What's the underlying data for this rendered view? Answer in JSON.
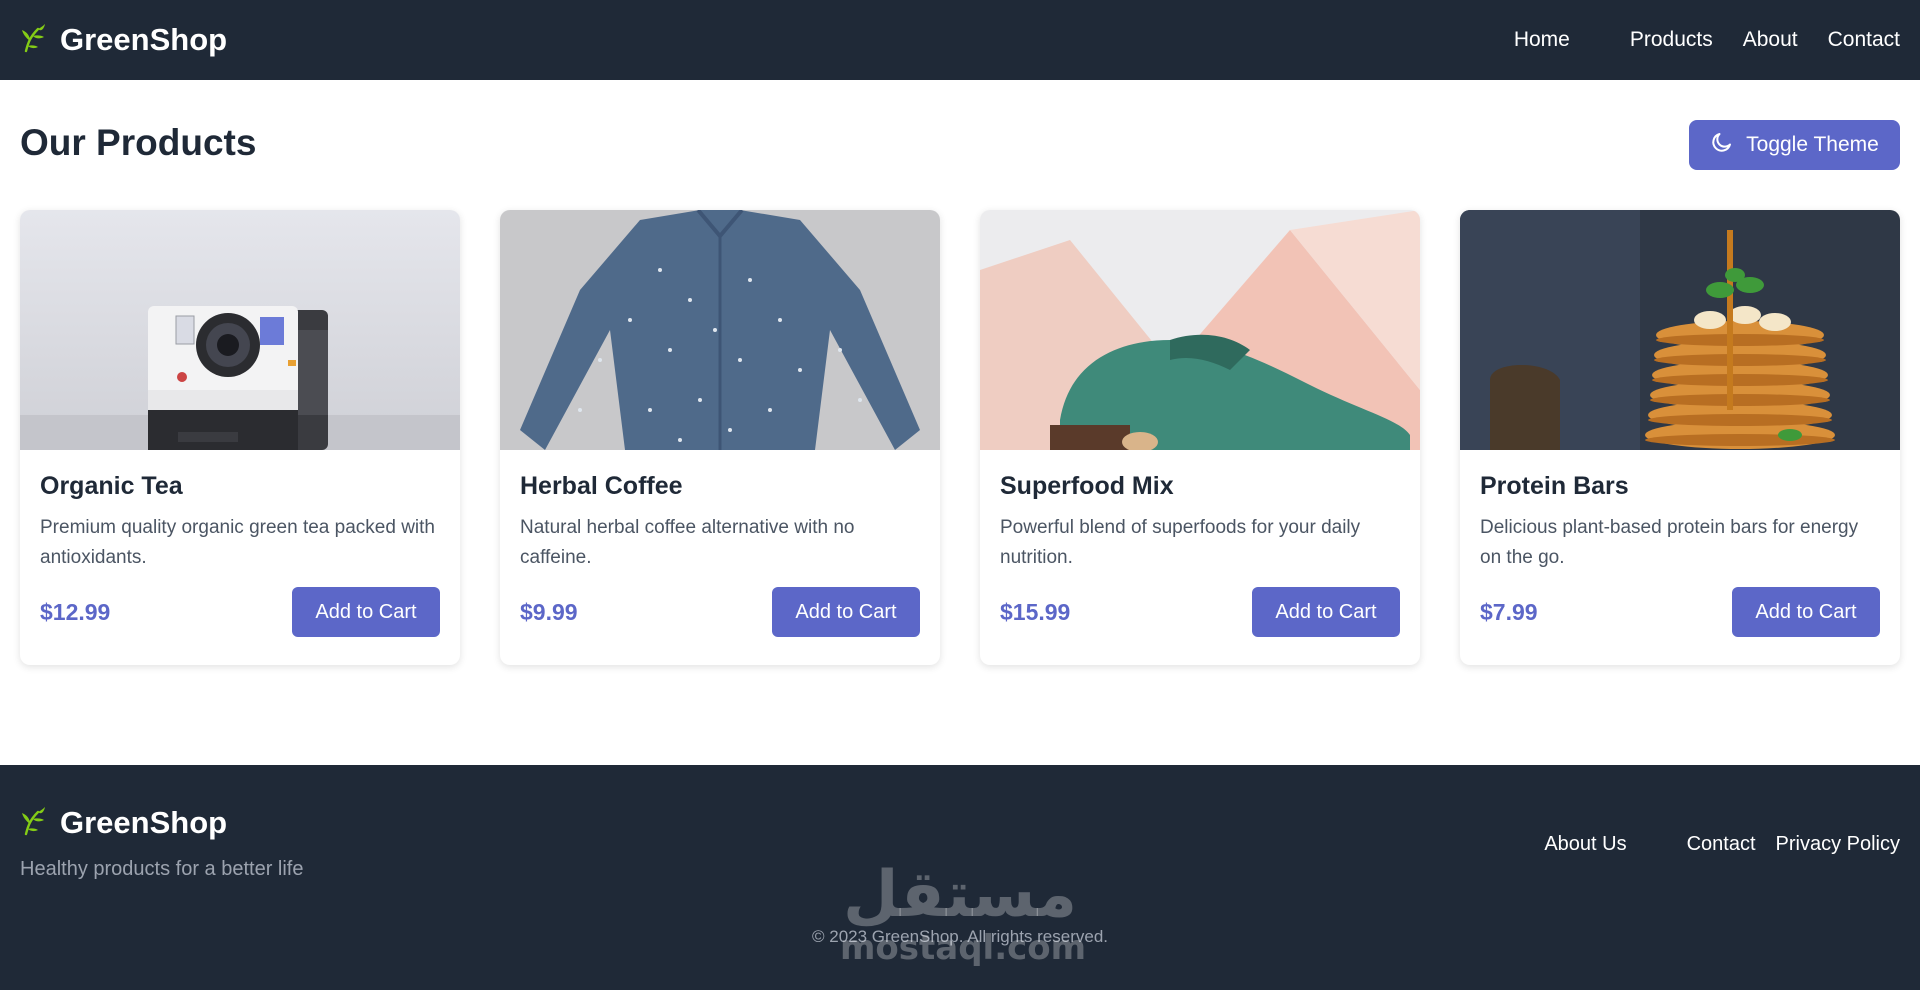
{
  "navbar": {
    "brand": "GreenShop",
    "links": [
      "Home",
      "Products",
      "About",
      "Contact"
    ]
  },
  "main": {
    "title": "Our Products",
    "theme_button": "Toggle Theme"
  },
  "products": [
    {
      "name": "Organic Tea",
      "description": "Premium quality organic green tea packed with antioxidants.",
      "price": "$12.99",
      "button": "Add to Cart"
    },
    {
      "name": "Herbal Coffee",
      "description": "Natural herbal coffee alternative with no caffeine.",
      "price": "$9.99",
      "button": "Add to Cart"
    },
    {
      "name": "Superfood Mix",
      "description": "Powerful blend of superfoods for your daily nutrition.",
      "price": "$15.99",
      "button": "Add to Cart"
    },
    {
      "name": "Protein Bars",
      "description": "Delicious plant-based protein bars for energy on the go.",
      "price": "$7.99",
      "button": "Add to Cart"
    }
  ],
  "footer": {
    "brand": "GreenShop",
    "tagline": "Healthy products for a better life",
    "links": [
      "About Us",
      "Contact",
      "Privacy Policy"
    ],
    "copyright": "© 2023 GreenShop. All rights reserved.",
    "watermark_ar": "مستقل",
    "watermark_en": "mostaql.com"
  },
  "colors": {
    "navbar_bg": "#1f2937",
    "accent": "#5c67c8",
    "leaf": "#84cc16"
  },
  "icons": {
    "brand": "leaf-icon",
    "theme": "moon-icon"
  }
}
